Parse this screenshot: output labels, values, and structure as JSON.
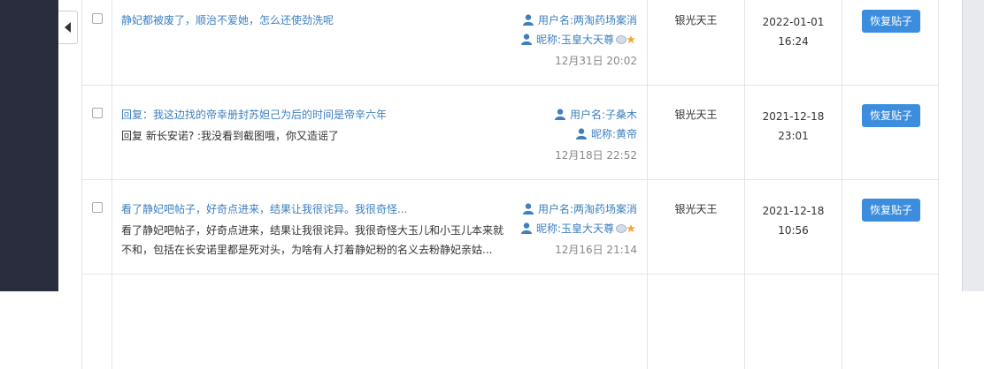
{
  "labels": {
    "user_prefix": "用户名: ",
    "nick_prefix": "昵称: ",
    "restore_button": "恢复贴子"
  },
  "colors": {
    "link": "#3d7fbf",
    "button": "#3c8dde",
    "sidebar": "#2a2d3e"
  },
  "rows": [
    {
      "title": "静妃都被废了，顺治不爱她，怎么还使劲洗呢",
      "body": "",
      "username": "两淘药场案消",
      "nickname": "玉皇大天尊",
      "has_badge": true,
      "date": "12月31日 20:02",
      "operator": "银光天王",
      "op_date": "2022-01-01",
      "op_time": "16:24"
    },
    {
      "title": "回复：我这边找的帝幸册封苏妲己为后的时间是帝辛六年",
      "body": "回复 新长安诺? :我没看到截图哦，你又造谣了",
      "username": "子桑木",
      "nickname": "黄帝",
      "has_badge": false,
      "date": "12月18日 22:52",
      "operator": "银光天王",
      "op_date": "2021-12-18",
      "op_time": "23:01"
    },
    {
      "title": "看了静妃吧帖子，好奇点进来，结果让我很诧异。我很奇怪...",
      "body": "看了静妃吧帖子，好奇点进来，结果让我很诧异。我很奇怪大玉儿和小玉儿本来就不和，包括在长安诺里都是死对头，为啥有人打着静妃粉的名义去粉静妃亲姑...",
      "username": "两淘药场案消",
      "nickname": "玉皇大天尊",
      "has_badge": true,
      "date": "12月16日 21:14",
      "operator": "银光天王",
      "op_date": "2021-12-18",
      "op_time": "10:56"
    }
  ]
}
